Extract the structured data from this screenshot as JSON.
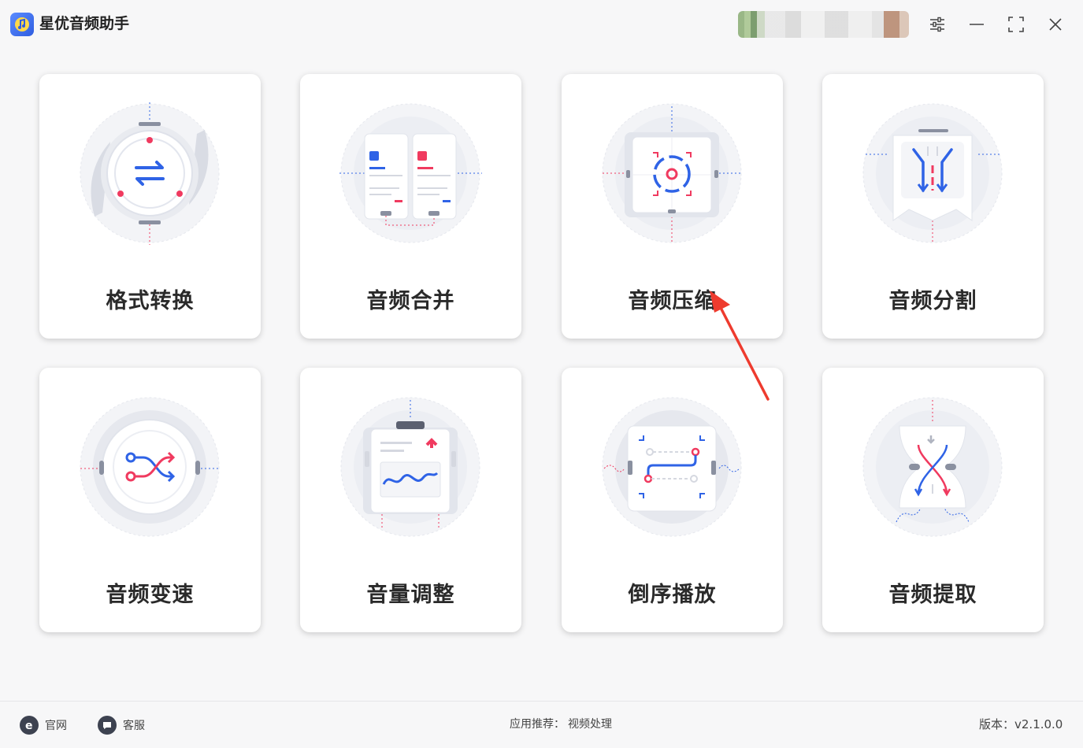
{
  "app": {
    "title": "星优音频助手",
    "accent": "#2f5de0"
  },
  "titlebar": {
    "user_avatar_icon": "pixelated-avatar",
    "settings_icon": "sliders-icon",
    "minimize_icon": "minimize-icon",
    "maximize_icon": "maximize-icon",
    "close_icon": "close-icon"
  },
  "cards": [
    {
      "label": "格式转换",
      "icon": "format-convert-icon"
    },
    {
      "label": "音频合并",
      "icon": "audio-merge-icon"
    },
    {
      "label": "音频压缩",
      "icon": "audio-compress-icon"
    },
    {
      "label": "音频分割",
      "icon": "audio-split-icon"
    },
    {
      "label": "音频变速",
      "icon": "audio-speed-icon"
    },
    {
      "label": "音量调整",
      "icon": "volume-adjust-icon"
    },
    {
      "label": "倒序播放",
      "icon": "reverse-play-icon"
    },
    {
      "label": "音频提取",
      "icon": "audio-extract-icon"
    }
  ],
  "footer": {
    "website": "官网",
    "support": "客服",
    "recommend_label": "应用推荐：",
    "recommend_link": "视频处理",
    "version": "版本：v2.1.0.0"
  },
  "colors": {
    "blue": "#2f63e6",
    "red": "#f03a5f",
    "card_bg": "#ffffff",
    "page_bg": "#f7f7f8"
  }
}
